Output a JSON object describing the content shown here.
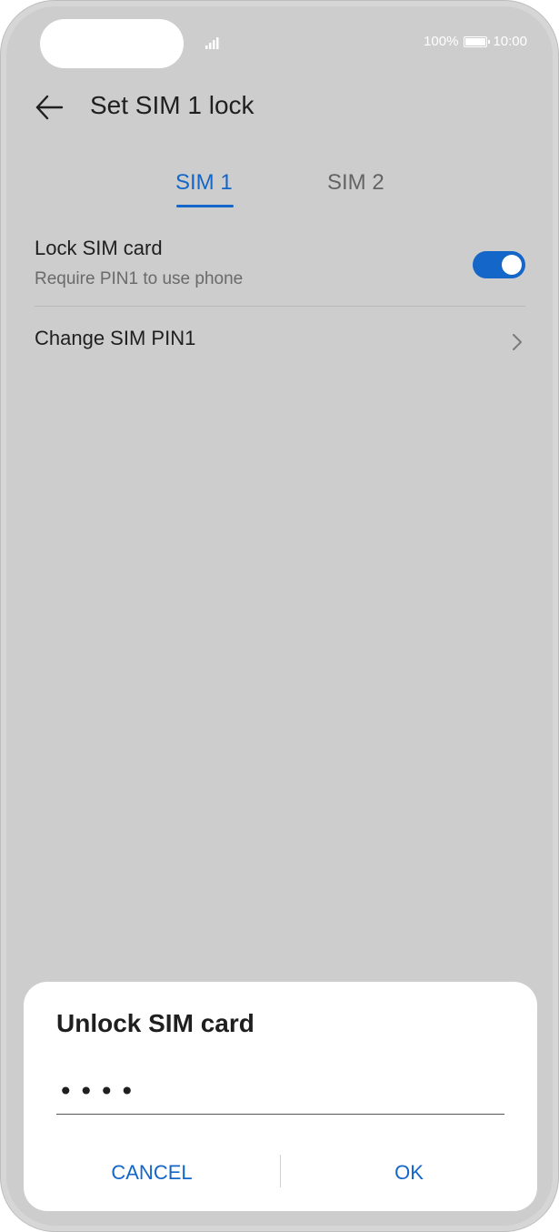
{
  "status_bar": {
    "battery_percent": "100%",
    "time": "10:00",
    "signal_icon": "signal-icon",
    "battery_icon": "battery-icon"
  },
  "app_bar": {
    "back_icon": "arrow-left-icon",
    "title": "Set SIM 1 lock"
  },
  "tabs": [
    {
      "label": "SIM 1",
      "selected": true
    },
    {
      "label": "SIM 2",
      "selected": false
    }
  ],
  "settings": {
    "lock_sim": {
      "title": "Lock SIM card",
      "subtitle": "Require PIN1 to use phone",
      "enabled": true
    },
    "change_pin": {
      "title": "Change SIM PIN1",
      "chevron_icon": "chevron-right-icon"
    }
  },
  "dialog": {
    "title": "Unlock SIM card",
    "pin_value": "••••",
    "cancel_label": "CANCEL",
    "ok_label": "OK"
  },
  "colors": {
    "accent": "#1466c8",
    "background": "#cdcdcd",
    "dialog_bg": "#ffffff",
    "text_primary": "#1f1f1f",
    "text_secondary": "#6a6a6a"
  }
}
